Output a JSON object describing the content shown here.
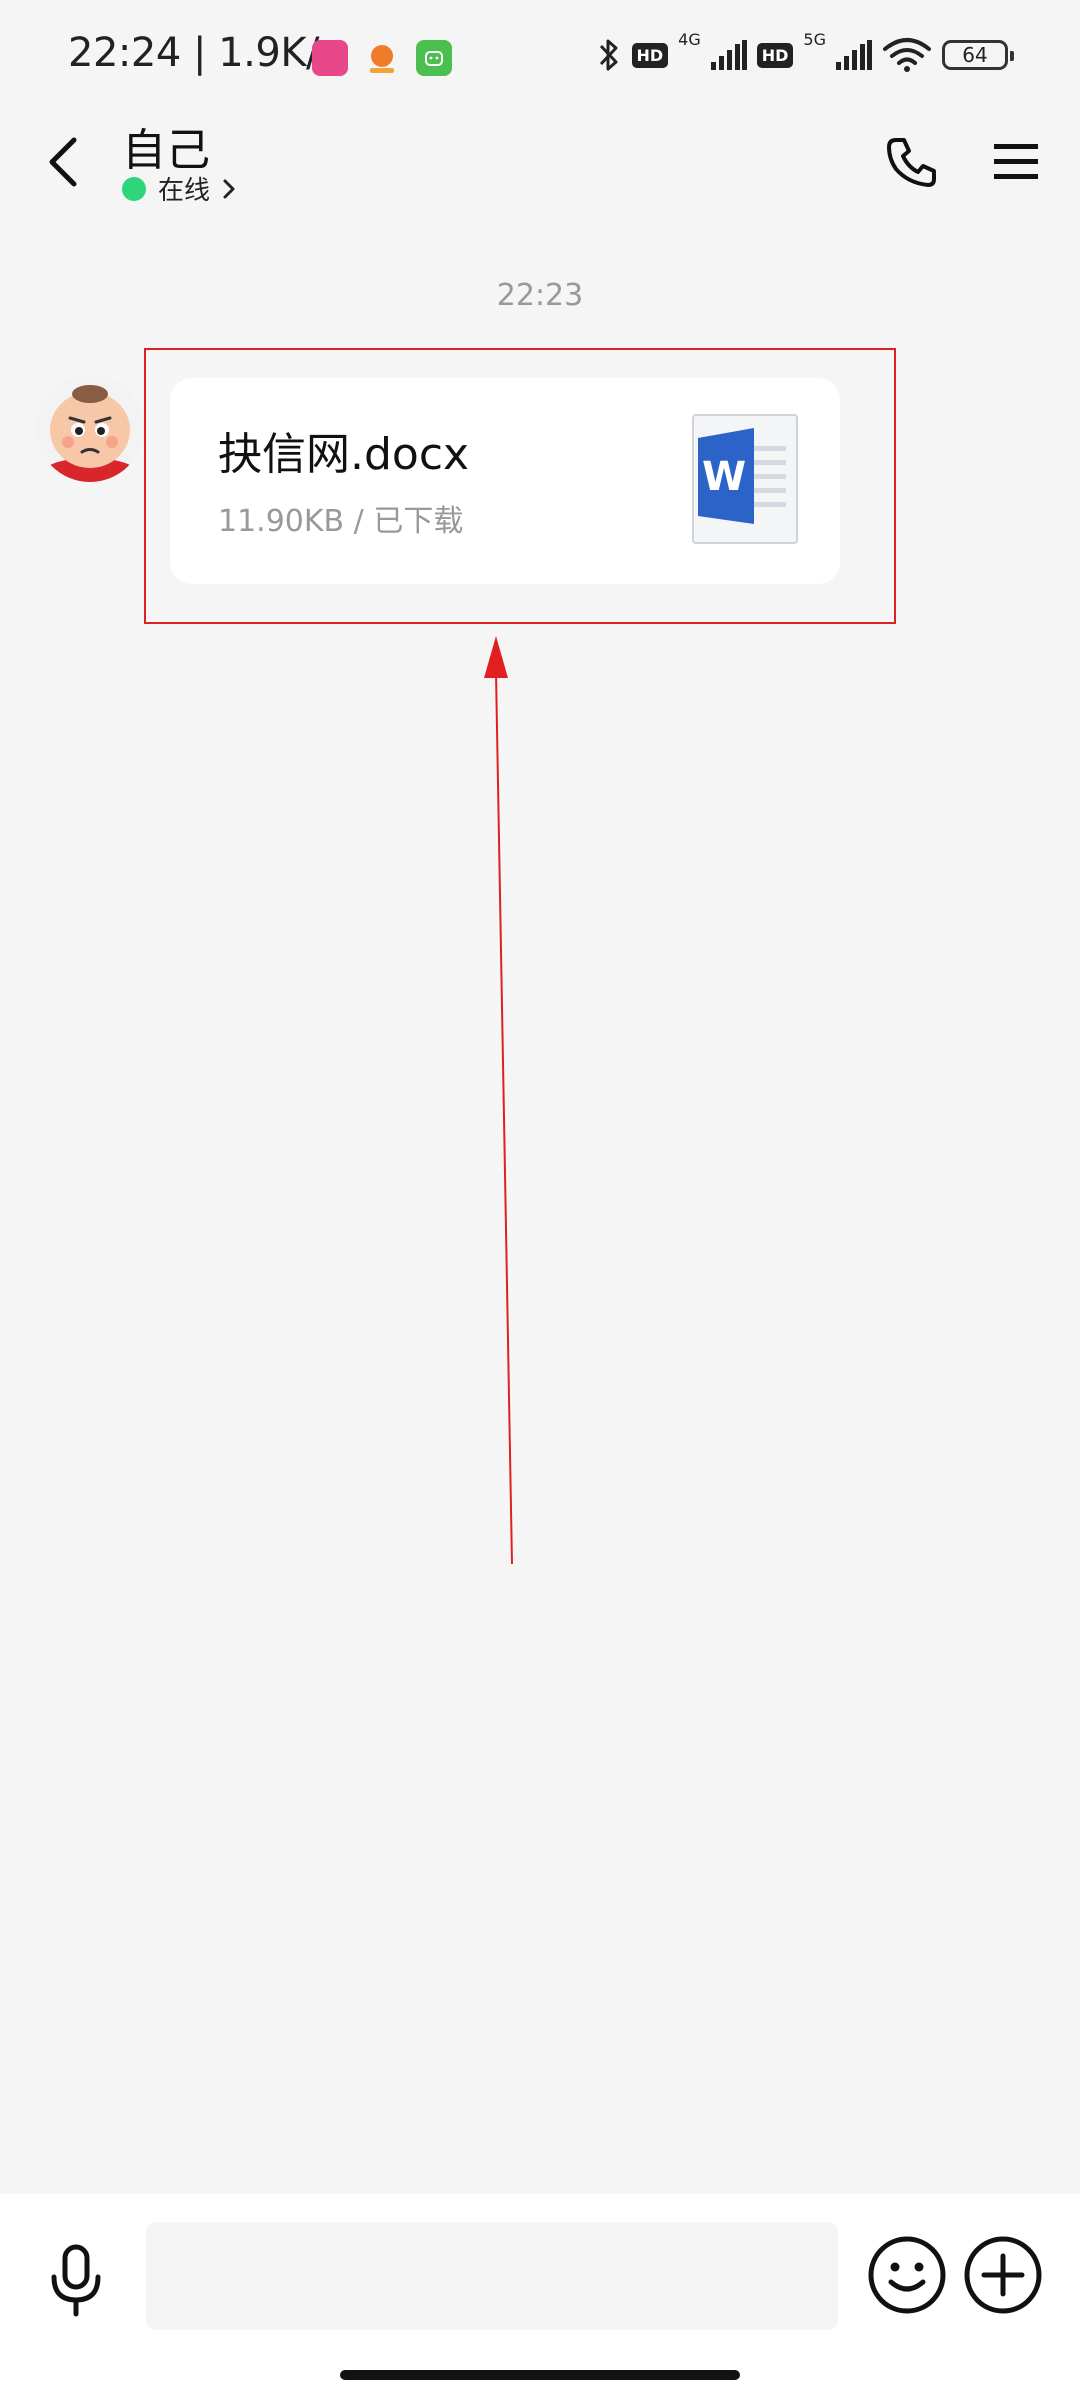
{
  "status_bar": {
    "time": "22:24",
    "speed": "1.9K/s",
    "network_1": "4G",
    "network_2": "5G",
    "hd_label": "HD",
    "battery": "64"
  },
  "header": {
    "title": "自己",
    "status": "在线"
  },
  "messages": {
    "timestamp": "22:23",
    "file": {
      "name": "抉信网.docx",
      "size": "11.90KB",
      "separator": " / ",
      "state": "已下载"
    }
  },
  "input": {
    "placeholder": "",
    "value": ""
  },
  "colors": {
    "background": "#f5f5f5",
    "online": "#2fd57b",
    "annotation": "#e02020",
    "word_blue": "#2b63c9"
  },
  "icons": {
    "back": "back-arrow-icon",
    "call": "phone-icon",
    "menu": "menu-icon",
    "file": "word-doc-icon",
    "voice": "microphone-icon",
    "emoji": "emoji-icon",
    "plus": "plus-circle-icon"
  }
}
